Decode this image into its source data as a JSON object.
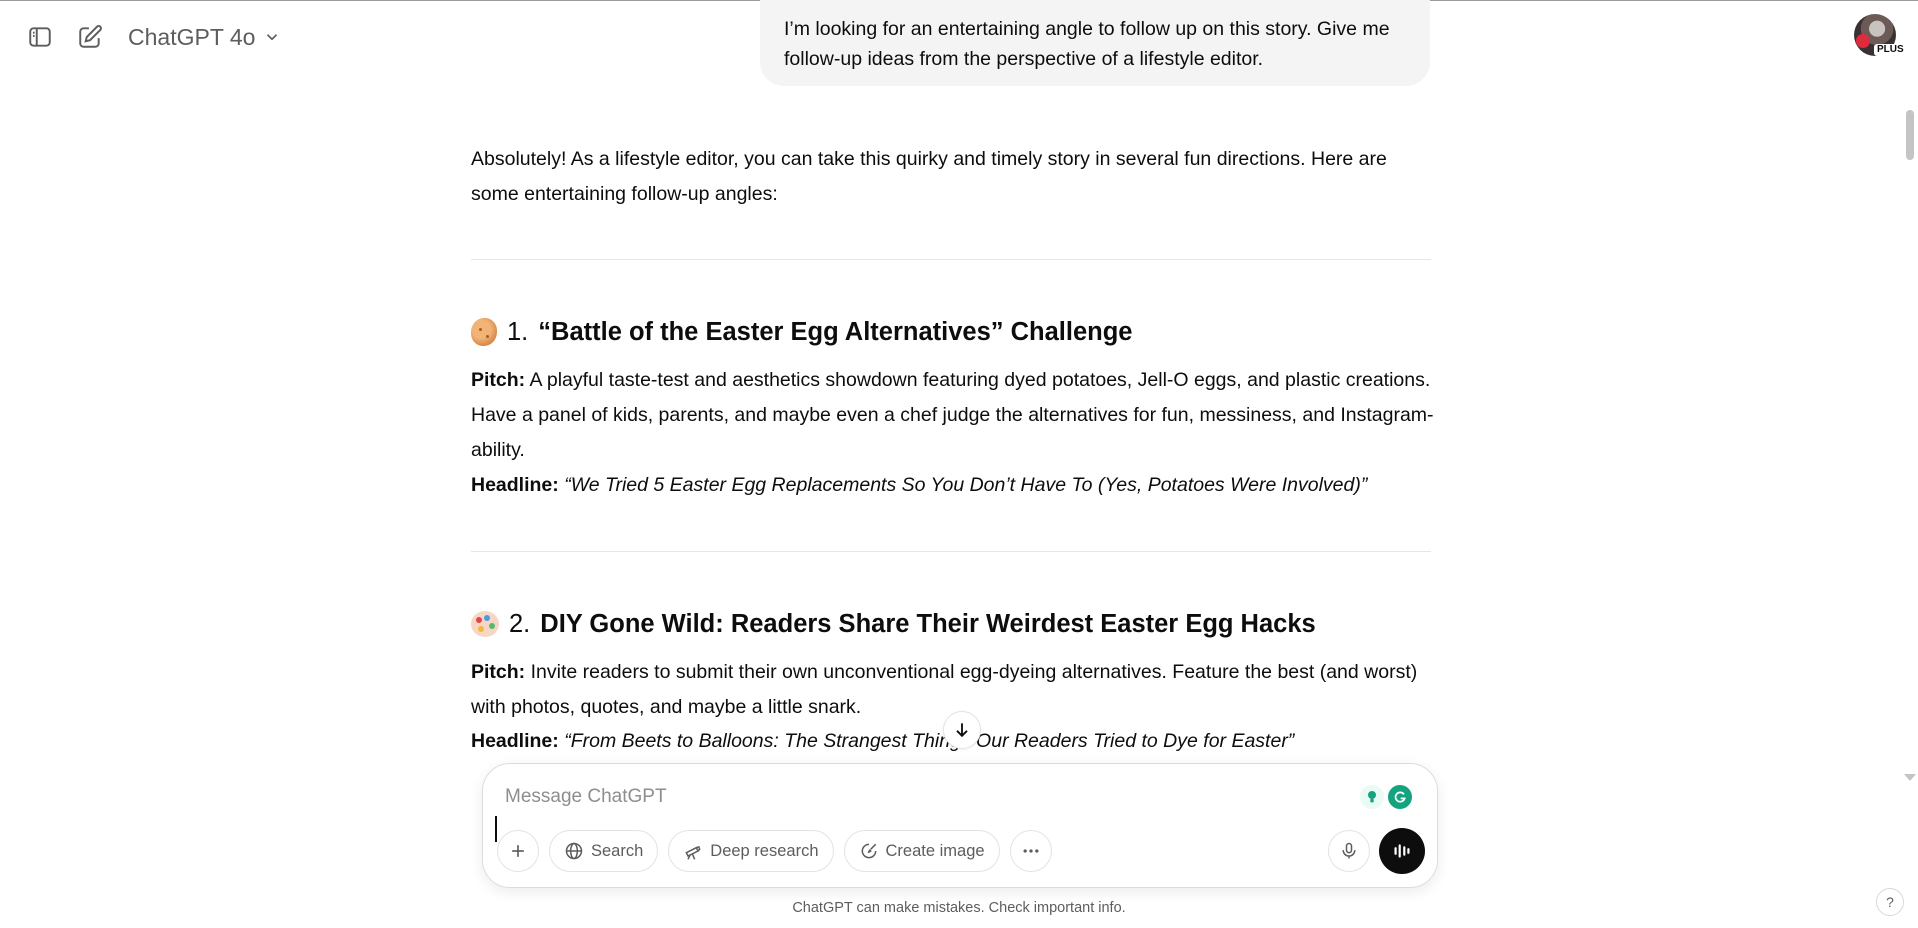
{
  "header": {
    "model_label": "ChatGPT 4o",
    "avatar_badge": "PLUS"
  },
  "user_message": "I’m looking for an entertaining angle to follow up on this story. Give me follow-up ideas from the perspective of a lifestyle editor.",
  "assistant": {
    "intro": "Absolutely! As a lifestyle editor, you can take this quirky and timely story in several fun directions. Here are some entertaining follow-up angles:",
    "sections": [
      {
        "emoji": "potato-emoji",
        "number": "1.",
        "title": "“Battle of the Easter Egg Alternatives” Challenge",
        "pitch_label": "Pitch:",
        "pitch": "A playful taste-test and aesthetics showdown featuring dyed potatoes, Jell-O eggs, and plastic creations. Have a panel of kids, parents, and maybe even a chef judge the alternatives for fun, messiness, and Instagram-ability.",
        "headline_label": "Headline:",
        "headline": "“We Tried 5 Easter Egg Replacements So You Don’t Have To (Yes, Potatoes Were Involved)”"
      },
      {
        "emoji": "palette-emoji",
        "number": "2.",
        "title": "DIY Gone Wild: Readers Share Their Weirdest Easter Egg Hacks",
        "pitch_label": "Pitch:",
        "pitch": "Invite readers to submit their own unconventional egg-dyeing alternatives. Feature the best (and worst) with photos, quotes, and maybe a little snark.",
        "headline_label": "Headline:",
        "headline": "“From Beets to Balloons: The Strangest Things Our Readers Tried to Dye for Easter”"
      }
    ]
  },
  "composer": {
    "placeholder": "Message ChatGPT",
    "tools": {
      "search": "Search",
      "deep_research": "Deep research",
      "create_image": "Create image"
    }
  },
  "disclaimer": "ChatGPT can make mistakes. Check important info.",
  "help_label": "?",
  "colors": {
    "text": "#0d0d0d",
    "muted": "#5d5d5d",
    "bubble": "#f4f4f4",
    "grammarly": "#14a37f"
  }
}
